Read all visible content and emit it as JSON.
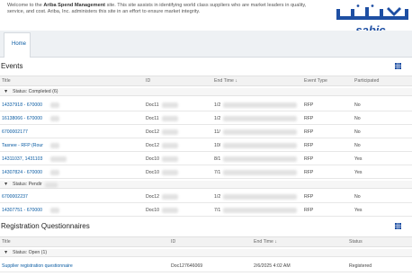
{
  "header": {
    "welcome_text": "Welcome to the Ariba Spend Management site. This site assists in identifying world class suppliers who are market leaders in quality, service, and cost. Ariba, Inc. administers this site in an effort to ensure market integrity.",
    "welcome_bold": "Ariba Spend Management",
    "logo_text": "sabic",
    "logo_color": "#1e4fa3"
  },
  "tabs": [
    {
      "label": "Home"
    }
  ],
  "events": {
    "title": "Events",
    "columns": [
      "Title",
      "ID",
      "End Time ↓",
      "Event Type",
      "Participated"
    ],
    "groups": [
      {
        "label": "Status: Completed  (6)"
      },
      {
        "label": "Status: Pendir"
      }
    ],
    "rows": [
      {
        "title": "14337918 - 670000",
        "id": "Doc11",
        "end": "1/2",
        "type": "RFP",
        "participated": "No"
      },
      {
        "title": "16138066 - 670000",
        "id": "Doc11",
        "end": "1/2",
        "type": "RFP",
        "participated": "No"
      },
      {
        "title": "6700002177",
        "id": "Doc12",
        "end": "11/",
        "type": "RFP",
        "participated": "No"
      },
      {
        "title": "Tasnee - RFP (Rour",
        "id": "Doc12",
        "end": "10/",
        "type": "RFP",
        "participated": "No"
      },
      {
        "title": "14311037, 1431103",
        "id": "Doc10",
        "end": "8/1",
        "type": "RFP",
        "participated": "Yes"
      },
      {
        "title": "14307824 - 670000",
        "id": "Doc10",
        "end": "7/1",
        "type": "RFP",
        "participated": "Yes"
      },
      {
        "title": "6700002237",
        "id": "Doc12",
        "end": "1/2",
        "type": "RFP",
        "participated": "No"
      },
      {
        "title": "14307751 - 670000",
        "id": "Doc10",
        "end": "7/1",
        "type": "RFP",
        "participated": "Yes"
      }
    ]
  },
  "questionnaires": {
    "title": "Registration Questionnaires",
    "columns": [
      "Title",
      "ID",
      "End Time ↓",
      "Status"
    ],
    "group": "Status: Open  (1)",
    "rows": [
      {
        "title": "Supplier registration questionnaire",
        "id": "Doc127646069",
        "end": "2/6/2025 4:02 AM",
        "status": "Registered"
      }
    ]
  },
  "colors": {
    "link": "#0b5ca3",
    "accent": "#1e4fa3"
  },
  "icons": [
    "sabic-logo",
    "grid-icon",
    "sort-down-icon",
    "triangle-down-icon"
  ]
}
